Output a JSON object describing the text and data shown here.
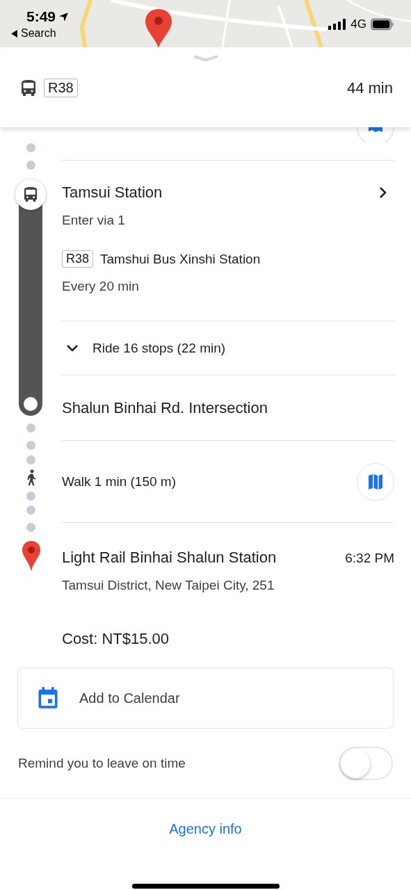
{
  "status_bar": {
    "time": "5:49",
    "back_label": "Search",
    "network": "4G"
  },
  "header": {
    "route": "R38",
    "duration": "44 min"
  },
  "board": {
    "title": "Tamsui Station",
    "subtitle": "Enter via 1",
    "route": "R38",
    "route_name": "Tamshui Bus Xinshi Station",
    "frequency": "Every 20 min"
  },
  "ride": {
    "label": "Ride 16 stops (22 min)",
    "expanded": false
  },
  "alight": {
    "title": "Shalun Binhai Rd. Intersection"
  },
  "walk": {
    "label": "Walk 1 min (150 m)"
  },
  "destination": {
    "title": "Light Rail Binhai Shalun Station",
    "time": "6:32 PM",
    "address": "Tamsui District, New Taipei City, 251"
  },
  "cost": "Cost: NT$15.00",
  "calendar_button": "Add to Calendar",
  "reminder": {
    "label": "Remind you to leave on time",
    "on": false
  },
  "footer_link": "Agency info"
}
